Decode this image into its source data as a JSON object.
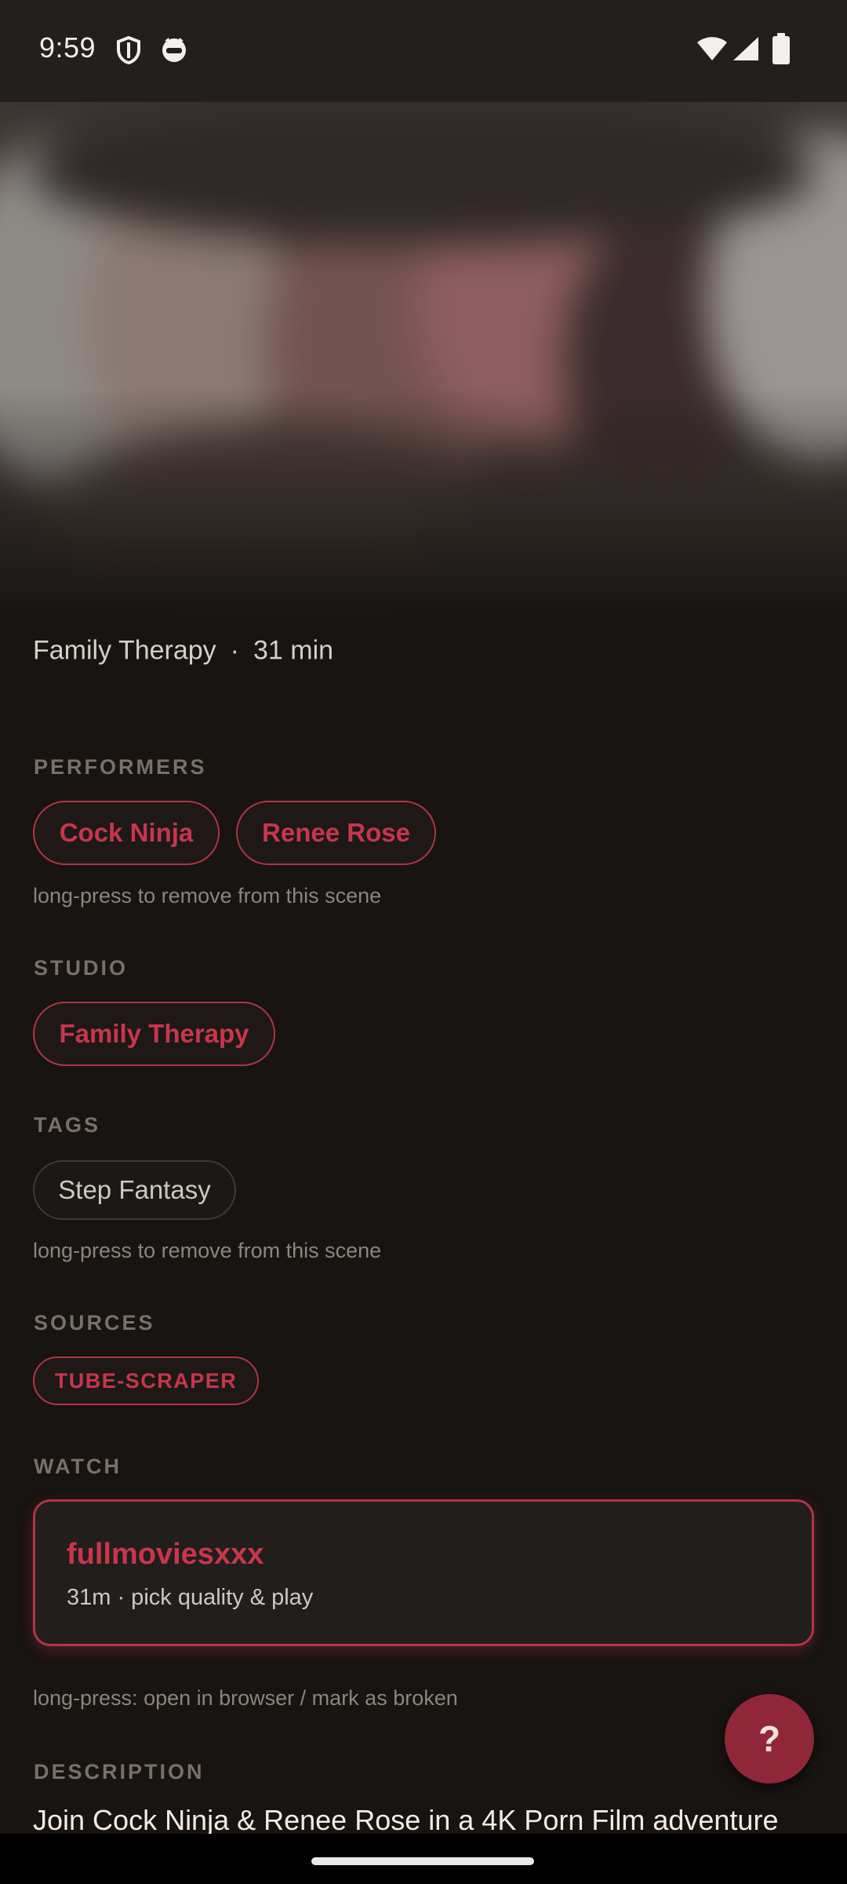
{
  "status": {
    "time": "9:59"
  },
  "scene": {
    "studio": "Family Therapy",
    "duration": "31 min",
    "separator": "·"
  },
  "performers": {
    "label": "PERFORMERS",
    "items": [
      "Cock Ninja",
      "Renee Rose"
    ],
    "hint": "long-press to remove from this scene"
  },
  "studio": {
    "label": "STUDIO",
    "name": "Family Therapy"
  },
  "tags": {
    "label": "TAGS",
    "items": [
      "Step Fantasy"
    ],
    "hint": "long-press to remove from this scene"
  },
  "sources": {
    "label": "SOURCES",
    "items": [
      "TUBE-SCRAPER"
    ]
  },
  "watch": {
    "label": "WATCH",
    "title": "fullmoviesxxx",
    "subtitle": "31m · pick quality & play",
    "hint": "long-press: open in browser / mark as broken"
  },
  "fab": {
    "label": "?"
  },
  "description": {
    "label": "DESCRIPTION",
    "text": "Join Cock Ninja & Renee Rose in a 4K Porn Film adventure"
  },
  "colors": {
    "accent": "#c7364c",
    "background": "#171411",
    "fab": "#8f2738"
  }
}
